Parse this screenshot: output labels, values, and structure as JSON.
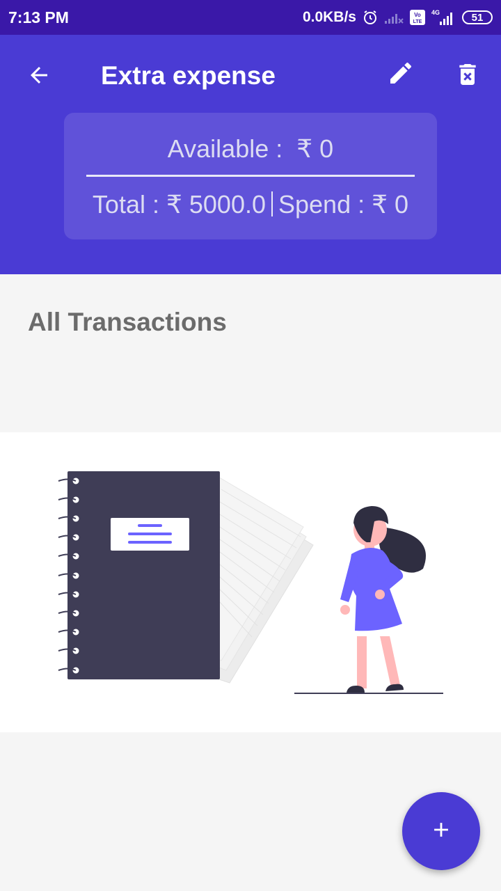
{
  "status_bar": {
    "time": "7:13 PM",
    "network_speed": "0.0KB/s",
    "volte_label": "Vo LTE",
    "network_type": "4G",
    "battery": "51",
    "icons": [
      "alarm-icon",
      "signal-weak-icon",
      "volte-icon",
      "signal-4g-icon",
      "battery-icon"
    ]
  },
  "header": {
    "title": "Extra expense",
    "icons": {
      "back": "arrow-left-icon",
      "edit": "pencil-icon",
      "delete": "trash-icon"
    }
  },
  "balance": {
    "available_label": "Available :",
    "available_value": "₹ 0",
    "total_label": "Total :",
    "total_value": "₹ 5000.0",
    "spend_label": "Spend :",
    "spend_value": "₹ 0"
  },
  "transactions": {
    "title": "All Transactions",
    "empty_illustration": "notebook-and-woman-illustration"
  },
  "fab": {
    "icon": "plus-icon"
  },
  "colors": {
    "status_bar": "#3a18a8",
    "primary": "#4a3bd4",
    "background": "#f5f5f5",
    "illustration_accent": "#6c63ff",
    "notebook": "#3f3d56"
  }
}
